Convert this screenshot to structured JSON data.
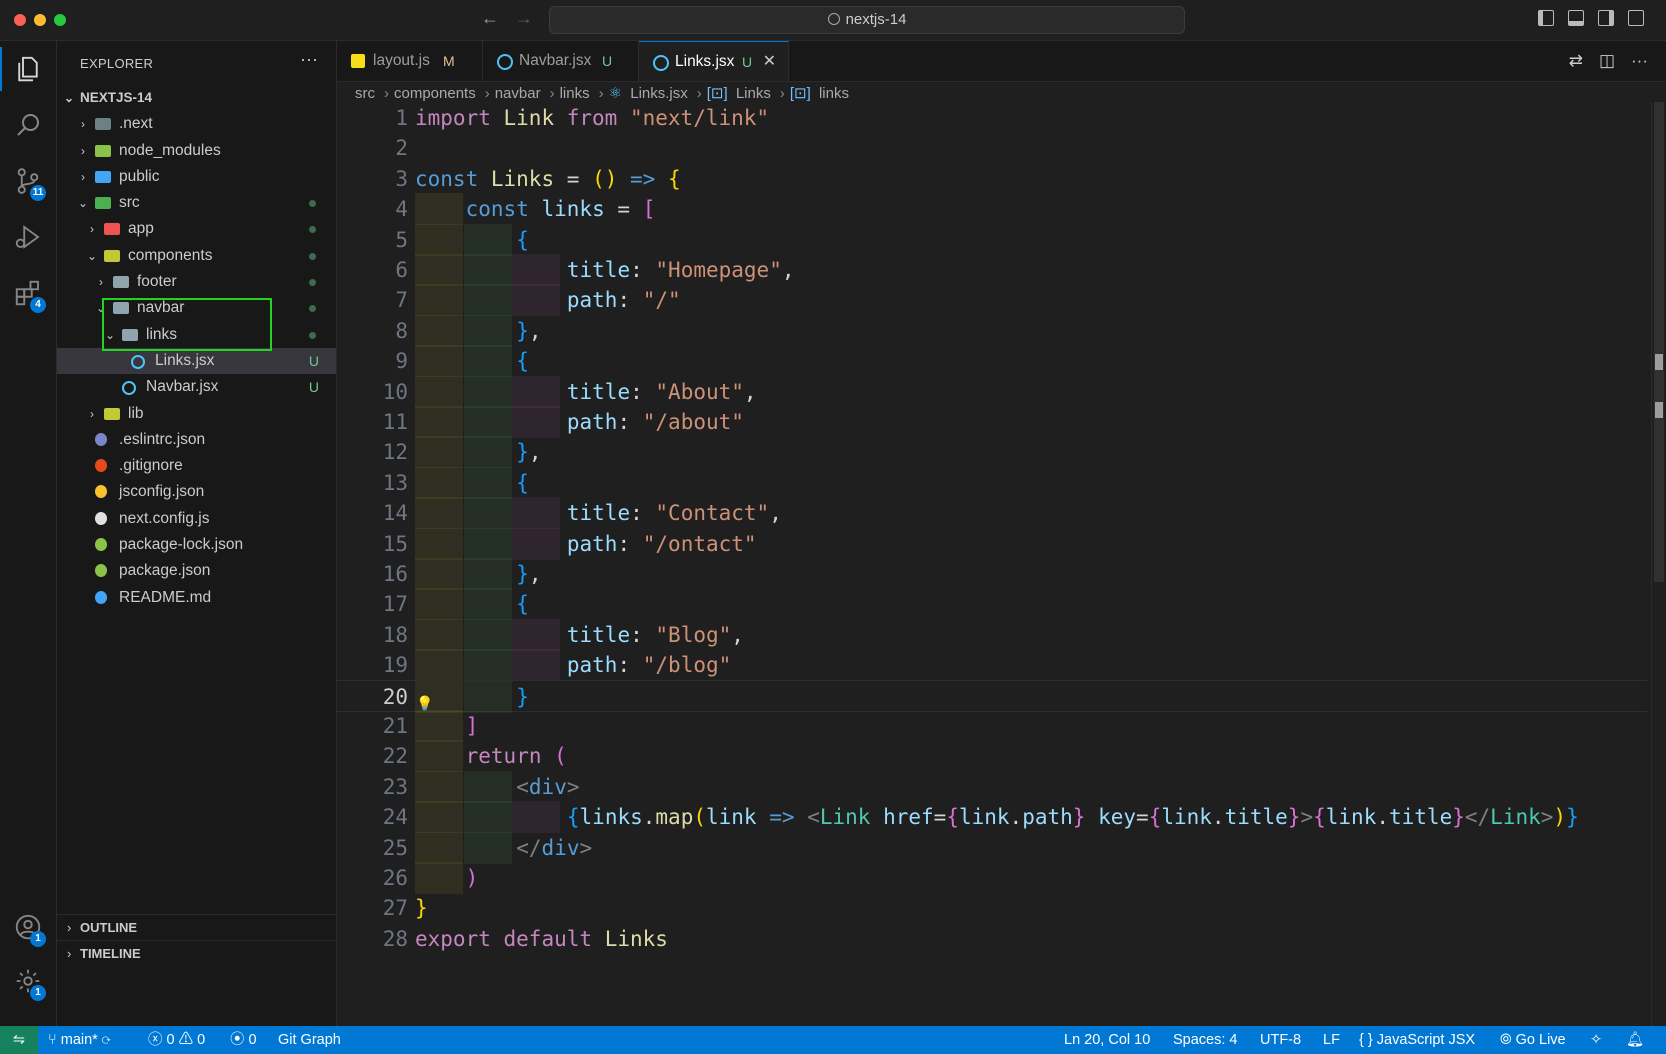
{
  "window": {
    "title": "nextjs-14"
  },
  "activity_bar": {
    "items": [
      {
        "icon": "files-icon",
        "badge": ""
      },
      {
        "icon": "search-icon",
        "badge": ""
      },
      {
        "icon": "source-control-icon",
        "badge": "11"
      },
      {
        "icon": "run-debug-icon",
        "badge": ""
      },
      {
        "icon": "extensions-icon",
        "badge": "4"
      }
    ],
    "bottom": [
      {
        "icon": "account-icon",
        "badge": "1"
      },
      {
        "icon": "settings-gear-icon",
        "badge": "1"
      }
    ]
  },
  "explorer": {
    "title": "EXPLORER",
    "more": "···",
    "root": "NEXTJS-14",
    "items": [
      {
        "label": ".next",
        "depth": 1,
        "chevron": "›",
        "type": "folder",
        "color": "#6d8086",
        "status": "",
        "dot": false
      },
      {
        "label": "node_modules",
        "depth": 1,
        "chevron": "›",
        "type": "folder",
        "color": "#8bc34a",
        "status": "",
        "dot": false
      },
      {
        "label": "public",
        "depth": 1,
        "chevron": "›",
        "type": "folder",
        "color": "#42a5f5",
        "status": "",
        "dot": false
      },
      {
        "label": "src",
        "depth": 1,
        "chevron": "⌄",
        "type": "folder",
        "color": "#4caf50",
        "status": "",
        "dot": true
      },
      {
        "label": "app",
        "depth": 2,
        "chevron": "›",
        "type": "folder",
        "color": "#ef5350",
        "status": "",
        "dot": true
      },
      {
        "label": "components",
        "depth": 2,
        "chevron": "⌄",
        "type": "folder",
        "color": "#c0ca33",
        "status": "",
        "dot": true
      },
      {
        "label": "footer",
        "depth": 3,
        "chevron": "›",
        "type": "folder",
        "color": "#90a4ae",
        "status": "",
        "dot": true
      },
      {
        "label": "navbar",
        "depth": 3,
        "chevron": "⌄",
        "type": "folder",
        "color": "#90a4ae",
        "status": "",
        "dot": true
      },
      {
        "label": "links",
        "depth": 4,
        "chevron": "⌄",
        "type": "folder",
        "color": "#90a4ae",
        "status": "",
        "dot": true
      },
      {
        "label": "Links.jsx",
        "depth": 5,
        "chevron": "",
        "type": "react",
        "color": "#4fc3f7",
        "status": "U",
        "dot": false,
        "selected": true
      },
      {
        "label": "Navbar.jsx",
        "depth": 4,
        "chevron": "",
        "type": "react",
        "color": "#4fc3f7",
        "status": "U",
        "dot": false
      },
      {
        "label": "lib",
        "depth": 2,
        "chevron": "›",
        "type": "folder",
        "color": "#c0ca33",
        "status": "",
        "dot": false
      },
      {
        "label": ".eslintrc.json",
        "depth": 1,
        "chevron": "",
        "type": "file",
        "color": "#7986cb",
        "status": "",
        "dot": false
      },
      {
        "label": ".gitignore",
        "depth": 1,
        "chevron": "",
        "type": "file",
        "color": "#e64a19",
        "status": "",
        "dot": false
      },
      {
        "label": "jsconfig.json",
        "depth": 1,
        "chevron": "",
        "type": "file",
        "color": "#fbc02d",
        "status": "",
        "dot": false
      },
      {
        "label": "next.config.js",
        "depth": 1,
        "chevron": "",
        "type": "file",
        "color": "#e0e0e0",
        "status": "",
        "dot": false
      },
      {
        "label": "package-lock.json",
        "depth": 1,
        "chevron": "",
        "type": "file",
        "color": "#8bc34a",
        "status": "",
        "dot": false
      },
      {
        "label": "package.json",
        "depth": 1,
        "chevron": "",
        "type": "file",
        "color": "#8bc34a",
        "status": "",
        "dot": false
      },
      {
        "label": "README.md",
        "depth": 1,
        "chevron": "",
        "type": "file",
        "color": "#42a5f5",
        "status": "",
        "dot": false
      }
    ],
    "outline": "OUTLINE",
    "timeline": "TIMELINE"
  },
  "tabs": [
    {
      "label": "layout.js",
      "status": "M",
      "status_color": "#e2c08d",
      "icon_color": "#f5de19",
      "active": false
    },
    {
      "label": "Navbar.jsx",
      "status": "U",
      "status_color": "#73c991",
      "icon_color": "#4fc3f7",
      "active": false
    },
    {
      "label": "Links.jsx",
      "status": "U",
      "status_color": "#73c991",
      "icon_color": "#4fc3f7",
      "active": true,
      "close": "✕"
    }
  ],
  "breadcrumb": [
    "src",
    "components",
    "navbar",
    "links",
    "Links.jsx",
    "Links",
    "links"
  ],
  "code": {
    "current_line": 20,
    "lines": [
      "import Link from \"next/link\"",
      "",
      "const Links = () => {",
      "    const links = [",
      "        {",
      "            title: \"Homepage\",",
      "            path: \"/\"",
      "        },",
      "        {",
      "            title: \"About\",",
      "            path: \"/about\"",
      "        },",
      "        {",
      "            title: \"Contact\",",
      "            path: \"/ontact\"",
      "        },",
      "        {",
      "            title: \"Blog\",",
      "            path: \"/blog\"",
      "        }",
      "    ]",
      "    return (",
      "        <div>",
      "            {links.map(link => <Link href={link.path} key={link.title}>{link.title}</Link>)}",
      "        </div>",
      "    )",
      "}",
      "export default Links"
    ]
  },
  "statusbar": {
    "branch": "main*",
    "errors": "0",
    "warnings": "0",
    "ports": "0",
    "git_graph": "Git Graph",
    "position": "Ln 20, Col 10",
    "spaces": "Spaces: 4",
    "encoding": "UTF-8",
    "eol": "LF",
    "language": "JavaScript JSX",
    "go_live": "Go Live"
  },
  "colors": {
    "accent": "#0078d4",
    "highlight_box": "#22d322"
  }
}
